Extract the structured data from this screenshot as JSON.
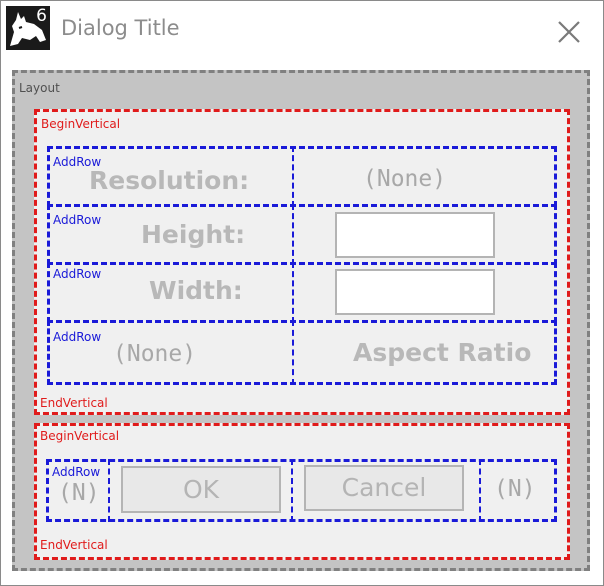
{
  "window": {
    "title": "Dialog Title",
    "app_icon": "rhino-icon",
    "app_version": "6",
    "close_icon": "close-icon"
  },
  "layout": {
    "label": "Layout",
    "section1": {
      "begin_label": "BeginVertical",
      "end_label": "EndVertical",
      "rows": [
        {
          "tag": "AddRow",
          "left": "Resolution:",
          "right": "(None)"
        },
        {
          "tag": "AddRow",
          "left": "Height:",
          "right_value": ""
        },
        {
          "tag": "AddRow",
          "left": "Width:",
          "right_value": ""
        },
        {
          "tag": "AddRow",
          "left": "(None)",
          "right": "Aspect Ratio"
        }
      ]
    },
    "section2": {
      "begin_label": "BeginVertical",
      "end_label": "EndVertical",
      "row": {
        "tag": "AddRow",
        "left": "(N)",
        "ok": "OK",
        "cancel": "Cancel",
        "right": "(N)"
      }
    }
  },
  "colors": {
    "layout_border": "#808080",
    "vertical_border": "#e01b1b",
    "row_border": "#1a1ad8",
    "layout_bg": "#c4c4c4",
    "vertical_bg": "#f0f0f0"
  }
}
